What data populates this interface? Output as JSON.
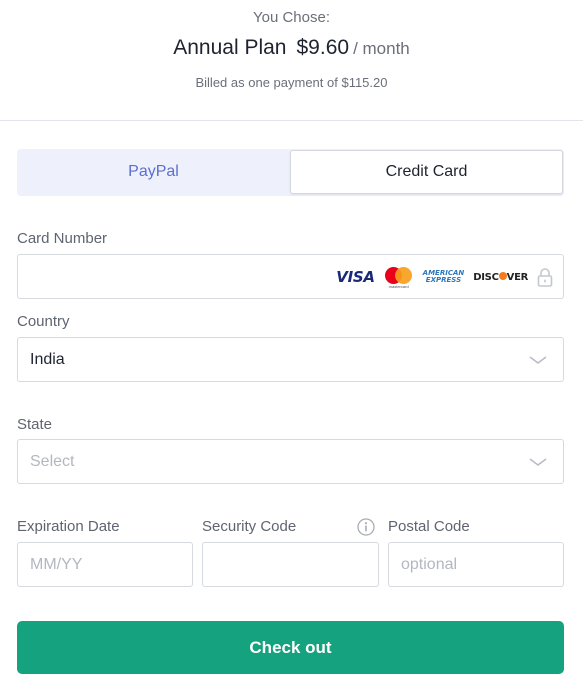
{
  "summary": {
    "you_chose": "You Chose:",
    "plan_name": "Annual Plan",
    "price": "$9.60",
    "per": "/ month",
    "billed": "Billed as one payment of $115.20"
  },
  "tabs": [
    {
      "label": "PayPal",
      "active": false
    },
    {
      "label": "Credit Card",
      "active": true
    }
  ],
  "card_number": {
    "label": "Card Number",
    "value": "",
    "logos": {
      "visa": "VISA",
      "mastercard": "mastercard",
      "amex_line1": "AMERICAN",
      "amex_line2": "EXPRESS",
      "discover_pre": "DISC",
      "discover_post": "VER"
    },
    "lock_icon": "lock-icon"
  },
  "country": {
    "label": "Country",
    "value": "India"
  },
  "state": {
    "label": "State",
    "placeholder": "Select"
  },
  "expiration": {
    "label": "Expiration Date",
    "placeholder": "MM/YY"
  },
  "security": {
    "label": "Security Code",
    "value": "",
    "info_icon": "info-icon"
  },
  "postal": {
    "label": "Postal Code",
    "placeholder": "optional"
  },
  "checkout": {
    "label": "Check out"
  },
  "colors": {
    "accent": "#15a37f",
    "tab_inactive_text": "#5b6fcf",
    "tab_bg": "#eef1fb"
  }
}
